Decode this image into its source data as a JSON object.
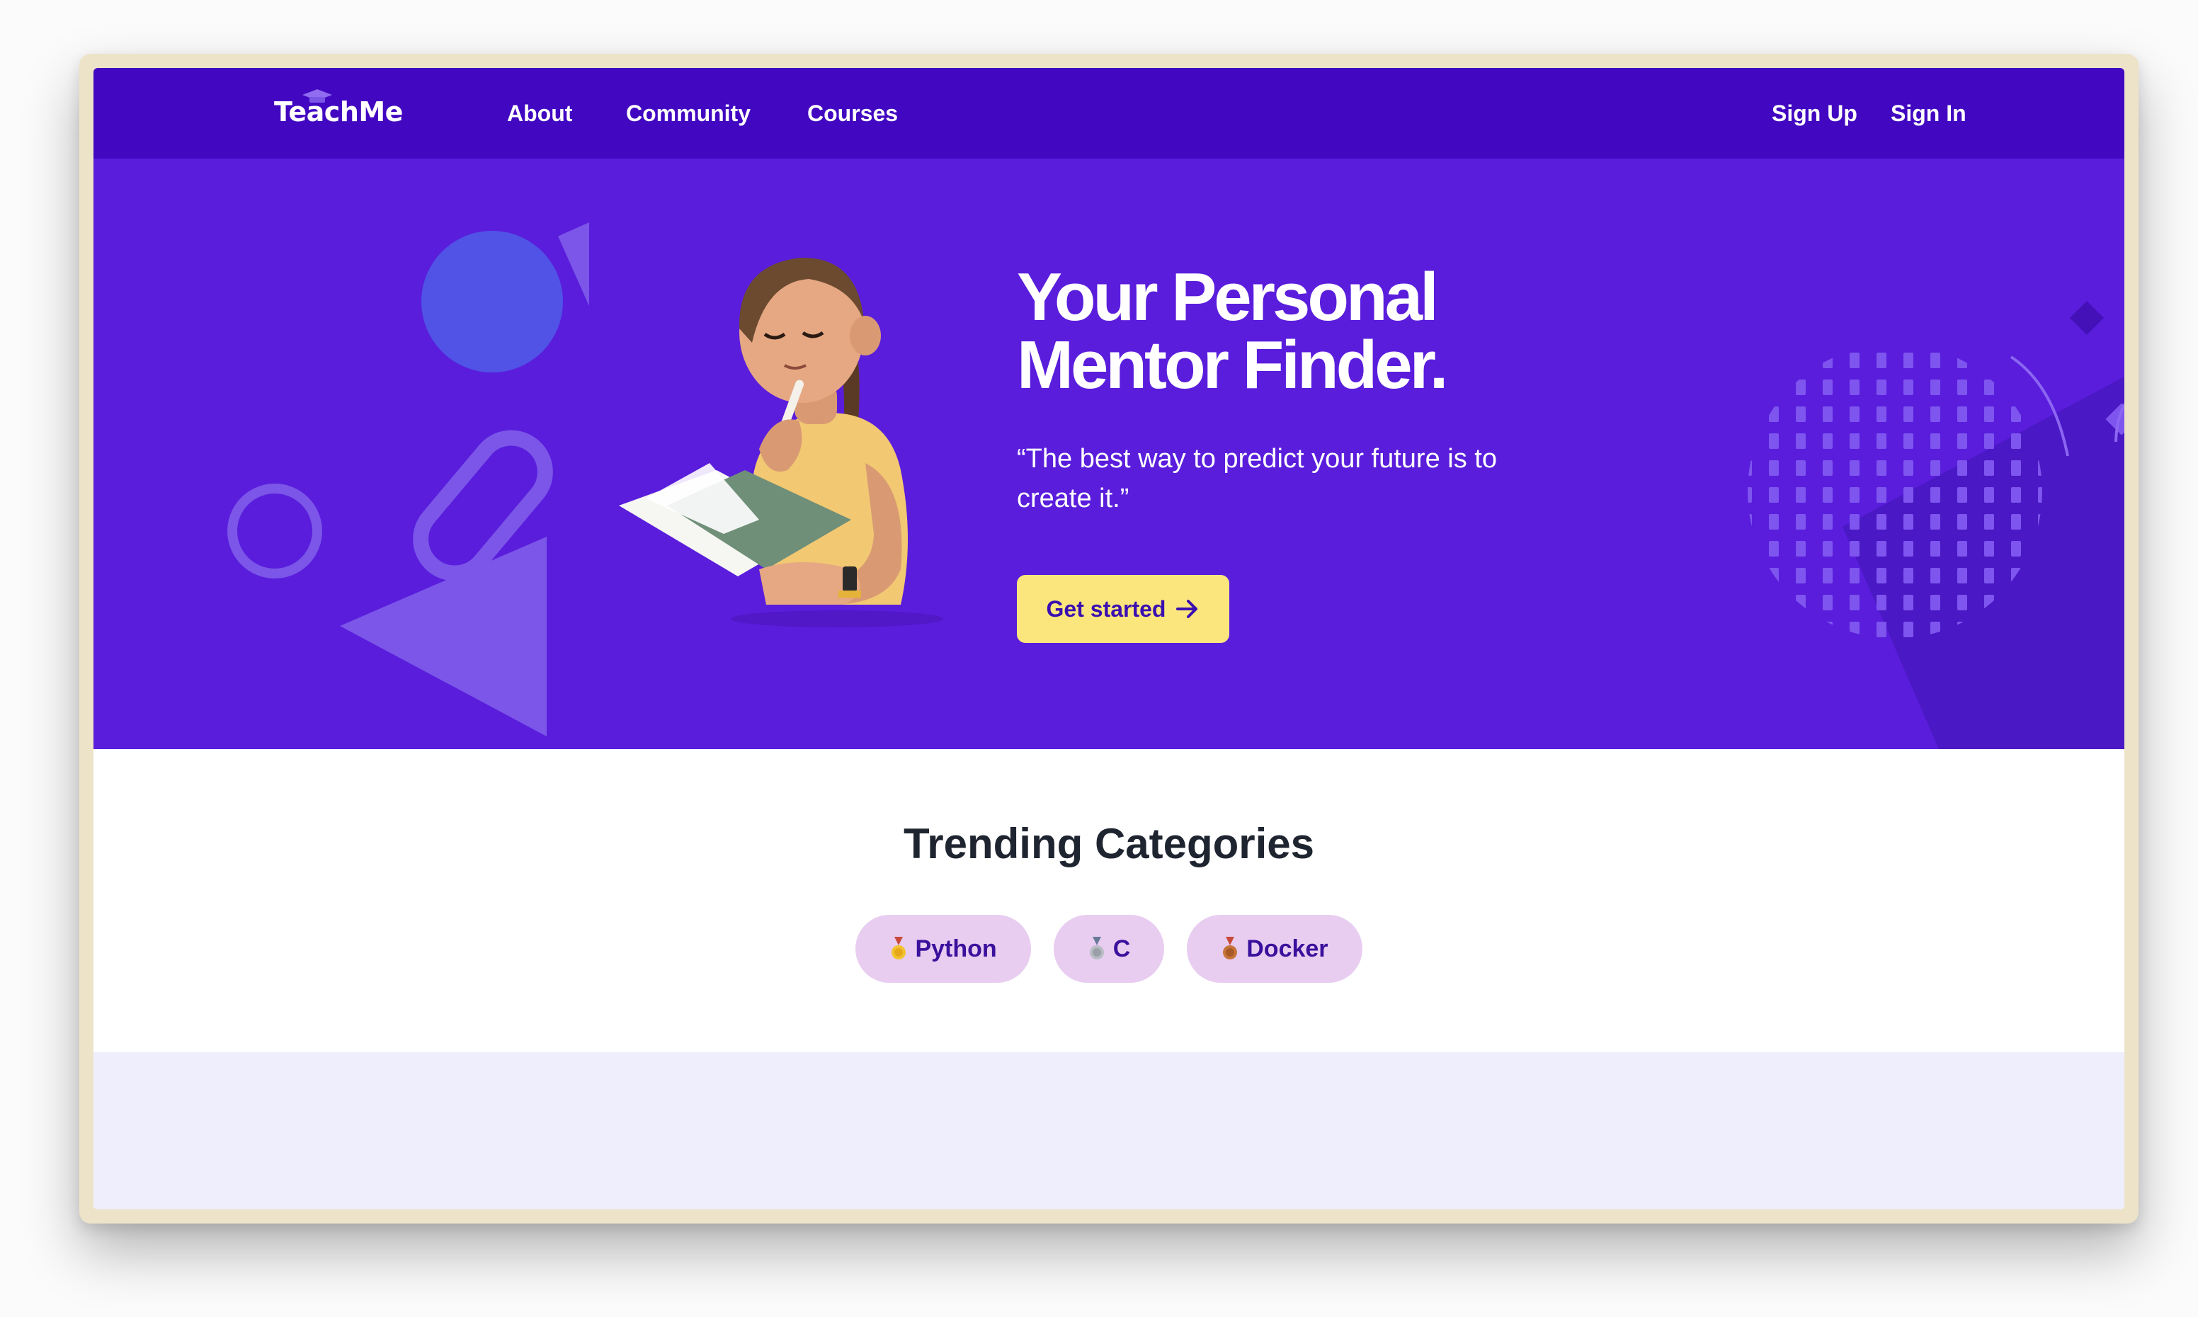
{
  "nav": {
    "logo": "TeachMe",
    "links": [
      "About",
      "Community",
      "Courses"
    ],
    "sign_up": "Sign Up",
    "sign_in": "Sign In"
  },
  "hero": {
    "title_line1": "Your Personal",
    "title_line2": "Mentor Finder.",
    "quote_line1": "“The best way to predict your future is to",
    "quote_line2": "create it.”",
    "cta_label": "Get started",
    "illustration": "student-reading-book-3d",
    "background_color": "#5a1ddc"
  },
  "trending": {
    "title": "Trending Categories",
    "chips": [
      {
        "label": "Python",
        "icon": "gold-medal-icon"
      },
      {
        "label": "C",
        "icon": "silver-medal-icon"
      },
      {
        "label": "Docker",
        "icon": "bronze-medal-icon"
      }
    ]
  },
  "colors": {
    "nav_bg": "#4208c1",
    "hero_bg": "#5a1ddc",
    "cta_bg": "#fbe67d",
    "chip_bg": "#e8cdf1",
    "footer_band": "#efeefc"
  }
}
